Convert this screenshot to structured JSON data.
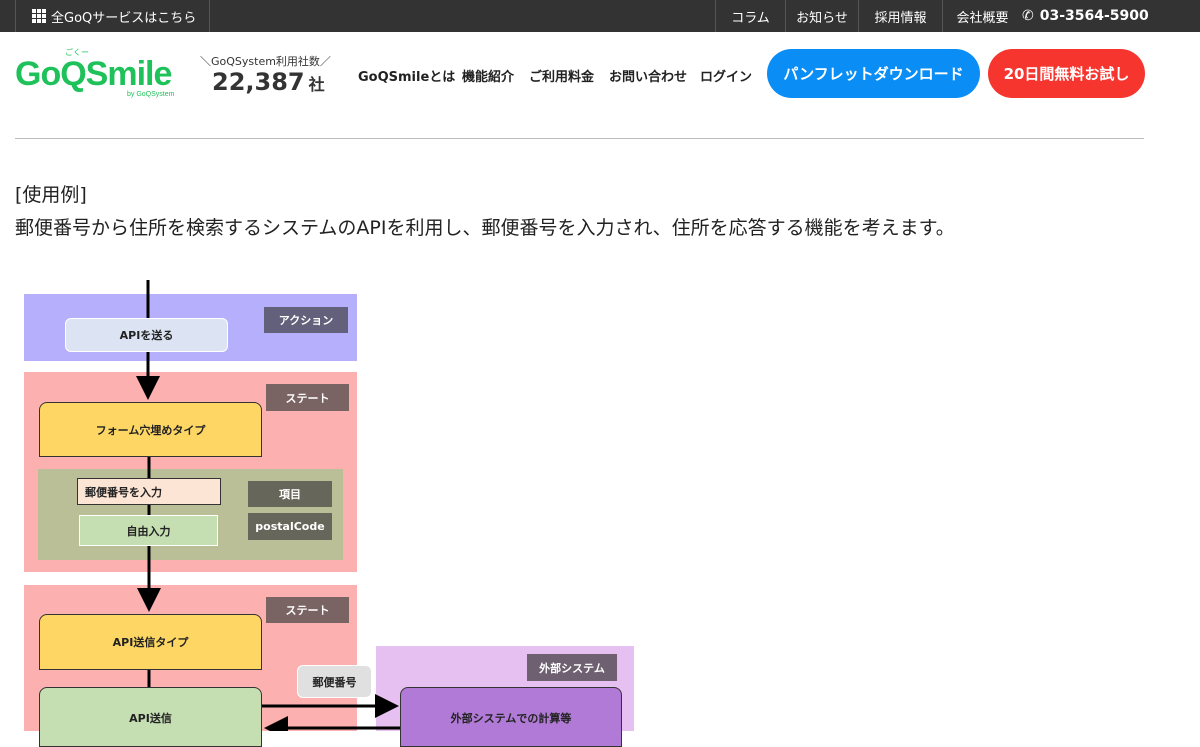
{
  "topbar": {
    "services": "全GoQサービスはこちら",
    "links": [
      "コラム",
      "お知らせ",
      "採用情報",
      "会社概要"
    ],
    "phone": "03-3564-5900"
  },
  "header": {
    "logo": "GoQSmile",
    "logo_ruby": "ごくー",
    "logo_sub": "by GoQSystem",
    "count_label": "＼GoQSystem利用社数／",
    "count": "22,387",
    "count_unit": "社",
    "nav": [
      "GoQSmileとは",
      "機能紹介",
      "ご利用料金",
      "お問い合わせ",
      "ログイン"
    ],
    "pamphlet": "パンフレットダウンロード",
    "trial": "20日間無料お試し"
  },
  "content": {
    "line1": "[使用例]",
    "line2": "郵便番号から住所を検索するシステムのAPIを利用し、郵便番号を入力され、住所を応答する機能を考えます。"
  },
  "diagram": {
    "action_label": "アクション",
    "send_api": "APIを送る",
    "state_label": "ステート",
    "form_type": "フォーム穴埋めタイプ",
    "postal_input": "郵便番号を入力",
    "free_input": "自由入力",
    "item_label": "項目",
    "item_value": "postalCode",
    "api_type": "API送信タイプ",
    "api_send": "API送信",
    "postal_bubble": "郵便番号",
    "ext_label": "外部システム",
    "ext_calc": "外部システムでの計算等"
  },
  "colors": {
    "green": "#1fc25a",
    "blue": "#0a8ef5",
    "red": "#f5352e"
  }
}
